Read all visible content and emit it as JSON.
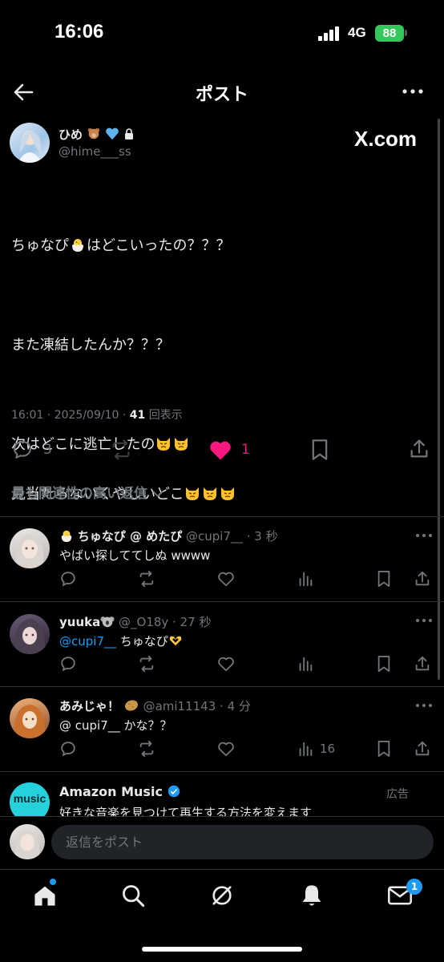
{
  "status_bar": {
    "time": "16:06",
    "network": "4G",
    "battery": "88"
  },
  "header": {
    "title": "ポスト"
  },
  "post": {
    "display_name": "ひめ",
    "handle": "@hime___ss",
    "watermark": "X.com",
    "lines": [
      "ちゅなぴ",
      "はどこいったの？？？",
      "また凍結したんか？？？",
      "次はどこに逃亡したの",
      "見当たらないくやしいどこ"
    ],
    "time": "16:01 · 2025/09/10 · ",
    "views": "41",
    "views_label": "回表示",
    "replies": "3",
    "likes": "1"
  },
  "sort_label": "最も関連性の高い返信",
  "replies": [
    {
      "name": "ちゅなぴ @ めたぴ",
      "handle": "@cupi7__ · 3 秒",
      "text": "やばい探しててしぬ wwww",
      "views": ""
    },
    {
      "name": "yuuka",
      "handle": "@_O18y · 27 秒",
      "mention": "@cupi7__",
      "text": " ちゅなぴ",
      "views": ""
    },
    {
      "name": "あみじゃ！",
      "handle": "@ami11143 · 4 分",
      "text": "@ cupi7__ かな？？",
      "views": "16"
    }
  ],
  "ad": {
    "name": "Amazon Music",
    "label": "広告",
    "text": "好きな音楽を見つけて再生する方法を変えます",
    "logo_text": "music"
  },
  "reply_placeholder": "返信をポスト",
  "tabbar": {
    "notification_count": "1"
  },
  "colors": {
    "like": "#f91880",
    "link": "#1d9bf0",
    "accent_badge": "#1d9bf0",
    "battery": "#34c759"
  }
}
